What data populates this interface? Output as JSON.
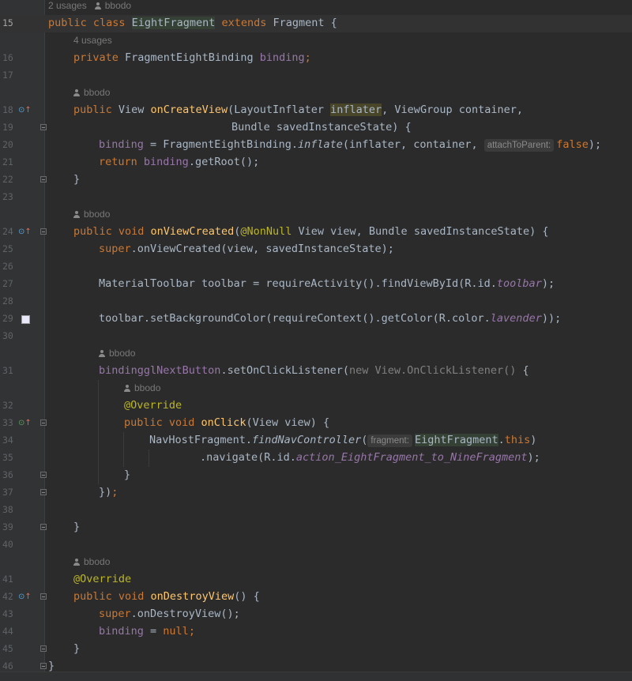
{
  "editor": {
    "language": "Java",
    "colors": {
      "background": "#2b2b2b",
      "keyword": "#cc7832",
      "method": "#ffc66d",
      "annotation": "#bbb529",
      "field": "#9876aa",
      "text": "#a9b7c6",
      "hint": "#787878",
      "lavender_swatch": "#e8e8f8"
    },
    "usage_hints": {
      "class_usages": "2 usages",
      "class_author": "bbodo",
      "binding_usages": "4 usages",
      "author_oncreateview": "bbodo",
      "author_onviewcreated": "bbodo",
      "author_listener": "bbodo",
      "author_onclick": "bbodo",
      "author_ondestroyview": "bbodo"
    },
    "inlay_hints": {
      "attach_to_parent": "attachToParent:",
      "fragment": "fragment:"
    },
    "line_numbers": [
      "15",
      "16",
      "17",
      "18",
      "19",
      "20",
      "21",
      "22",
      "23",
      "24",
      "25",
      "26",
      "27",
      "28",
      "29",
      "30",
      "31",
      "32",
      "33",
      "34",
      "35",
      "36",
      "37",
      "38",
      "39",
      "40",
      "41",
      "42",
      "43",
      "44",
      "45",
      "46"
    ],
    "gutter_icons": {
      "override_up": "override-up-icon",
      "implement": "implement-icon",
      "color_swatch": "lavender"
    },
    "code": {
      "l15": {
        "kw1": "public class ",
        "cls": "EightFragment",
        "kw2": " extends ",
        "rest": "Fragment {"
      },
      "l16": {
        "kw": "private ",
        "type": "FragmentEightBinding ",
        "field": "binding",
        "end": ";"
      },
      "l18": {
        "kw": "public ",
        "type": "View ",
        "fn": "onCreateView",
        "p1": "(LayoutInflater ",
        "param": "inflater",
        "p2": ", ViewGroup container,"
      },
      "l19": {
        "text": "Bundle savedInstanceState) {"
      },
      "l20": {
        "field": "binding",
        "eq": " = FragmentEightBinding.",
        "call": "inflate",
        "args": "(inflater, container, ",
        "val": "false",
        "end": ");"
      },
      "l21": {
        "kw": "return ",
        "field": "binding",
        ".rest": ".getRoot();",
        "rest": ".getRoot();"
      },
      "l22": {
        "text": "}"
      },
      "l24": {
        "kw": "public void ",
        "fn": "onViewCreated",
        "open": "(",
        "ann": "@NonNull",
        "rest": " View view, Bundle savedInstanceState) {"
      },
      "l25": {
        "kw": "super",
        "rest": ".onViewCreated(view, savedInstanceState);"
      },
      "l27": {
        "text": "MaterialToolbar toolbar = requireActivity().findViewById(R.id.",
        "ifield": "toolbar",
        "end": ");"
      },
      "l29": {
        "text": "toolbar.setBackgroundColor(requireContext().getColor(R.color.",
        "ifield": "lavender",
        "end": "));"
      },
      "l31": {
        "field": "binding",
        ".": ".",
        "field2": "glNextButton",
        "rest": ".setOnClickListener(",
        "gray": "new View.OnClickListener()",
        "end": " {"
      },
      "l32": {
        "ann": "@Override"
      },
      "l33": {
        "kw": "public void ",
        "fn": "onClick",
        "rest": "(View view) {"
      },
      "l34": {
        "text": "NavHostFragment.",
        "call": "findNavController",
        "open": "(",
        "cls": "EightFragment",
        "dot": ".",
        "kw": "this",
        "end": ")"
      },
      "l35": {
        "text": ".navigate(R.id.",
        "ifield": "action_EightFragment_to_NineFragment",
        "end": ");"
      },
      "l36": {
        "text": "}"
      },
      "l37": {
        "text": "})",
        "end": ";"
      },
      "l39": {
        "text": "}"
      },
      "l41": {
        "ann": "@Override"
      },
      "l42": {
        "kw": "public void ",
        "fn": "onDestroyView",
        "rest": "() {"
      },
      "l43": {
        "kw": "super",
        "rest": ".onDestroyView();"
      },
      "l44": {
        "field": "binding",
        "eq": " = ",
        "kw": "null",
        "end": ";"
      },
      "l45": {
        "text": "}"
      },
      "l46": {
        "text": "}"
      }
    }
  }
}
